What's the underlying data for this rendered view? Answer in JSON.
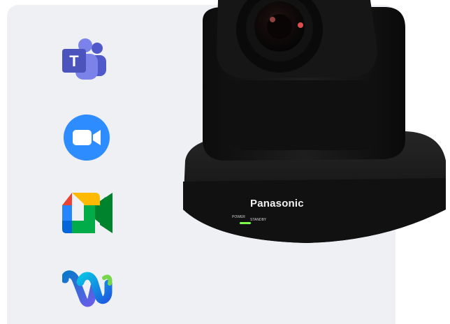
{
  "apps": [
    {
      "name": "Microsoft Teams",
      "icon": "teams-icon",
      "color": "#5059C9"
    },
    {
      "name": "Zoom",
      "icon": "zoom-icon",
      "color": "#2D8CFF"
    },
    {
      "name": "Google Meet",
      "icon": "google-meet-icon",
      "color": "#00832D"
    },
    {
      "name": "Webex",
      "icon": "webex-icon",
      "color": "#07C1E4"
    }
  ],
  "camera": {
    "brand": "Panasonic",
    "power_label": "POWER",
    "standby_label": "STANDBY",
    "body_color": "#141414",
    "led_color": "#7CFF4A"
  },
  "panel_color": "#eef0f4"
}
